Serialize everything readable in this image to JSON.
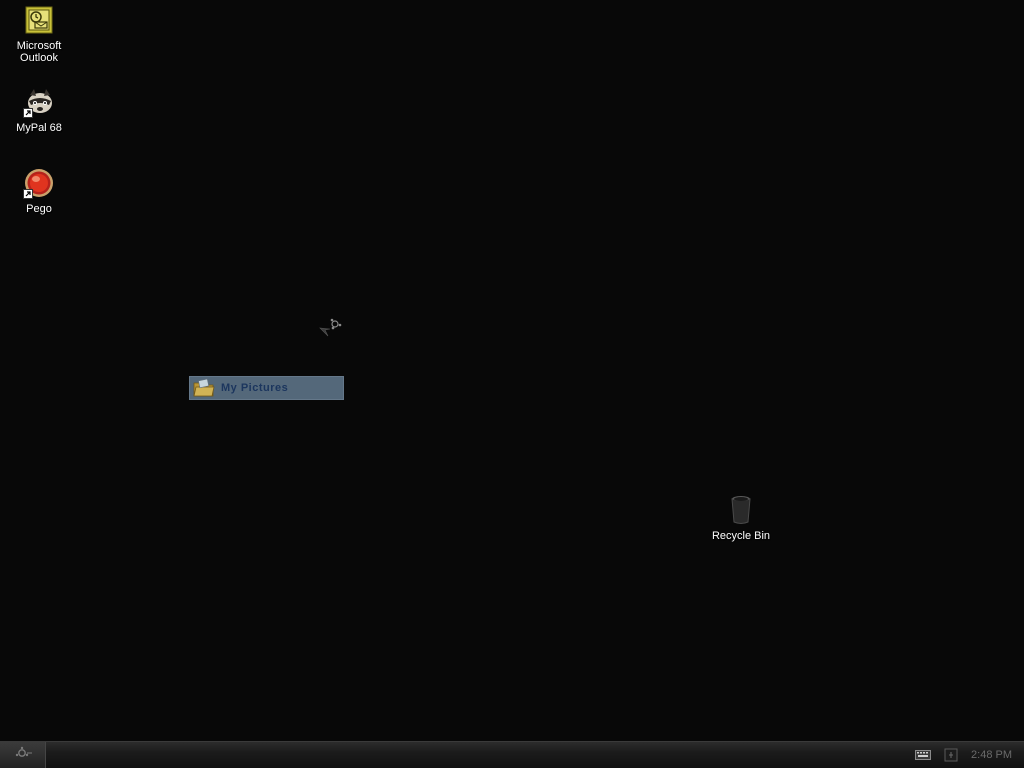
{
  "desktop": {
    "icons": [
      {
        "label_line1": "Microsoft",
        "label_line2": "Outlook",
        "icon": "outlook-icon"
      },
      {
        "label": "MyPal 68",
        "icon": "mypal-icon"
      },
      {
        "label": "Pego",
        "icon": "pego-icon"
      },
      {
        "label": "Recycle Bin",
        "icon": "recycle-bin-icon"
      }
    ],
    "drag_ghost": {
      "label": "My Pictures",
      "icon": "folder-icon"
    }
  },
  "taskbar": {
    "start_icon": "start-gear-icon",
    "tray": {
      "keyboard_icon": "keyboard-icon",
      "network_icon": "network-icon",
      "clock": "2:48 PM"
    }
  },
  "colors": {
    "desktop_bg": "#080808",
    "ghost_bg": "#5b7184",
    "ghost_text": "#1e3a66",
    "clock_text": "#6a6a6a"
  }
}
